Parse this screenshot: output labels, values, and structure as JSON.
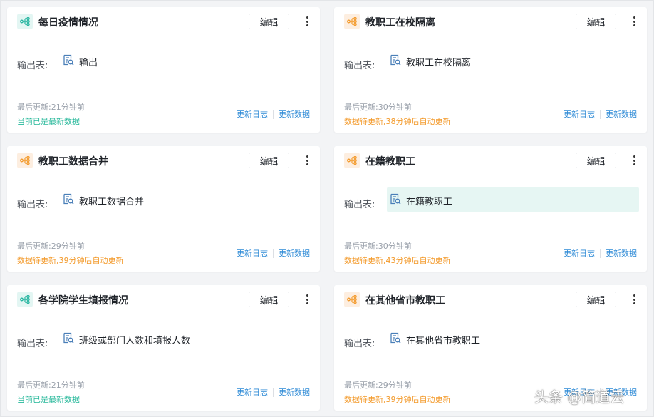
{
  "labels": {
    "edit": "编辑",
    "output_label": "输出表:",
    "update_log": "更新日志",
    "update_data": "更新数据"
  },
  "cards": [
    {
      "title": "每日疫情情况",
      "icon_color": "teal",
      "output_table": "输出",
      "last_update": "最后更新:21分钟前",
      "status": "当前已是最新数据",
      "status_type": "ok",
      "highlighted": false
    },
    {
      "title": "教职工在校隔离",
      "icon_color": "orange",
      "output_table": "教职工在校隔离",
      "last_update": "最后更新:30分钟前",
      "status": "数据待更新,38分钟后自动更新",
      "status_type": "pending",
      "highlighted": false
    },
    {
      "title": "教职工数据合并",
      "icon_color": "orange",
      "output_table": "教职工数据合并",
      "last_update": "最后更新:29分钟前",
      "status": "数据待更新,39分钟后自动更新",
      "status_type": "pending",
      "highlighted": false
    },
    {
      "title": "在籍教职工",
      "icon_color": "orange",
      "output_table": "在籍教职工",
      "last_update": "最后更新:30分钟前",
      "status": "数据待更新,43分钟后自动更新",
      "status_type": "pending",
      "highlighted": true
    },
    {
      "title": "各学院学生填报情况",
      "icon_color": "teal",
      "output_table": "班级或部门人数和填报人数",
      "last_update": "最后更新:21分钟前",
      "status": "当前已是最新数据",
      "status_type": "ok",
      "highlighted": false
    },
    {
      "title": "在其他省市教职工",
      "icon_color": "orange",
      "output_table": "在其他省市教职工",
      "last_update": "最后更新:29分钟前",
      "status": "数据待更新,39分钟后自动更新",
      "status_type": "pending",
      "highlighted": false
    }
  ],
  "colors": {
    "teal": "#26b5a0",
    "orange": "#f39a2b",
    "link": "#2d8ad6",
    "table_icon": "#4a7fb8"
  },
  "icons": {
    "flow": "dataflow-icon",
    "table": "table-file-icon",
    "more": "more-vertical-icon"
  },
  "watermark": "头条 @简道云"
}
